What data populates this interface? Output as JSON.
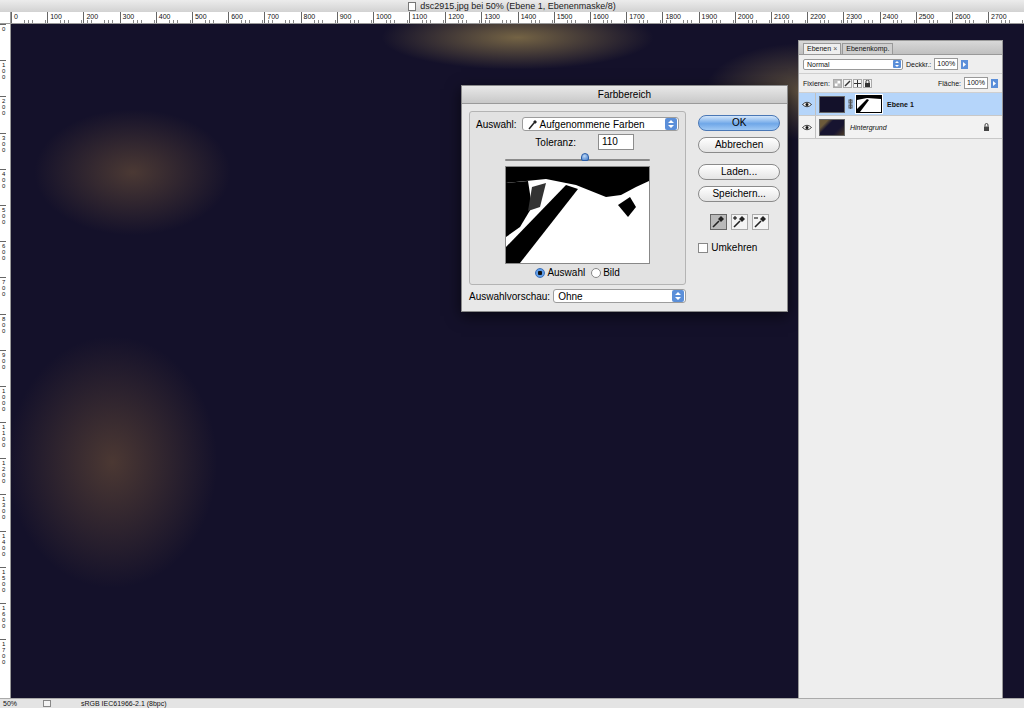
{
  "window": {
    "title": "dsc2915.jpg bei 50% (Ebene 1, Ebenenmaske/8)"
  },
  "ruler": {
    "top": [
      "0",
      "100",
      "200",
      "300",
      "400",
      "500",
      "600",
      "700",
      "800",
      "900",
      "1000",
      "1100",
      "1200",
      "1300",
      "1400",
      "1500",
      "1600",
      "1700",
      "1800",
      "1900",
      "2000",
      "2100",
      "2200",
      "2300",
      "2400",
      "2500",
      "2600",
      "2700"
    ],
    "left": [
      "0",
      "100",
      "200",
      "300",
      "400",
      "500",
      "600",
      "700",
      "800",
      "900",
      "1000",
      "1100",
      "1200",
      "1300",
      "1400",
      "1500",
      "1600",
      "1700"
    ]
  },
  "dialog": {
    "title": "Farbbereich",
    "select_label": "Auswahl:",
    "select_value": "Aufgenommene Farben",
    "tolerance_label": "Toleranz:",
    "tolerance": "110",
    "tolerance_level": 0.55,
    "view_options": [
      {
        "label": "Auswahl",
        "selected": true
      },
      {
        "label": "Bild",
        "selected": false
      }
    ],
    "preview_label": "Auswahlvorschau:",
    "preview_value": "Ohne",
    "buttons": [
      {
        "label": "OK",
        "default": true
      },
      {
        "label": "Abbrechen",
        "default": false
      },
      {
        "label": "Laden...",
        "default": false
      },
      {
        "label": "Speichern...",
        "default": false
      }
    ],
    "eyedroppers": [
      {
        "kind": "sample",
        "selected": true
      },
      {
        "kind": "add",
        "selected": false
      },
      {
        "kind": "subtract",
        "selected": false
      }
    ],
    "invert": {
      "label": "Umkehren",
      "checked": false
    }
  },
  "layers_panel": {
    "tabs": [
      {
        "label": "Ebenen",
        "selected": true,
        "close": "×"
      },
      {
        "label": "Ebenenkomp.",
        "selected": false,
        "close": ""
      }
    ],
    "blend_mode": "Normal",
    "opacity_label": "Deckkr.:",
    "opacity": "100%",
    "lock_label": "Fixieren:",
    "fill_label": "Fläche:",
    "fill": "100%",
    "layers": [
      {
        "name": "Ebene 1",
        "selected": true,
        "visible": true,
        "has_mask": true,
        "locked": false,
        "italic": false
      },
      {
        "name": "Hintergrund",
        "selected": false,
        "visible": true,
        "has_mask": false,
        "locked": true,
        "italic": true
      }
    ]
  },
  "status_bar": {
    "zoom": "50%",
    "profile": "sRGB IEC61966-2.1 (8bpc)"
  }
}
